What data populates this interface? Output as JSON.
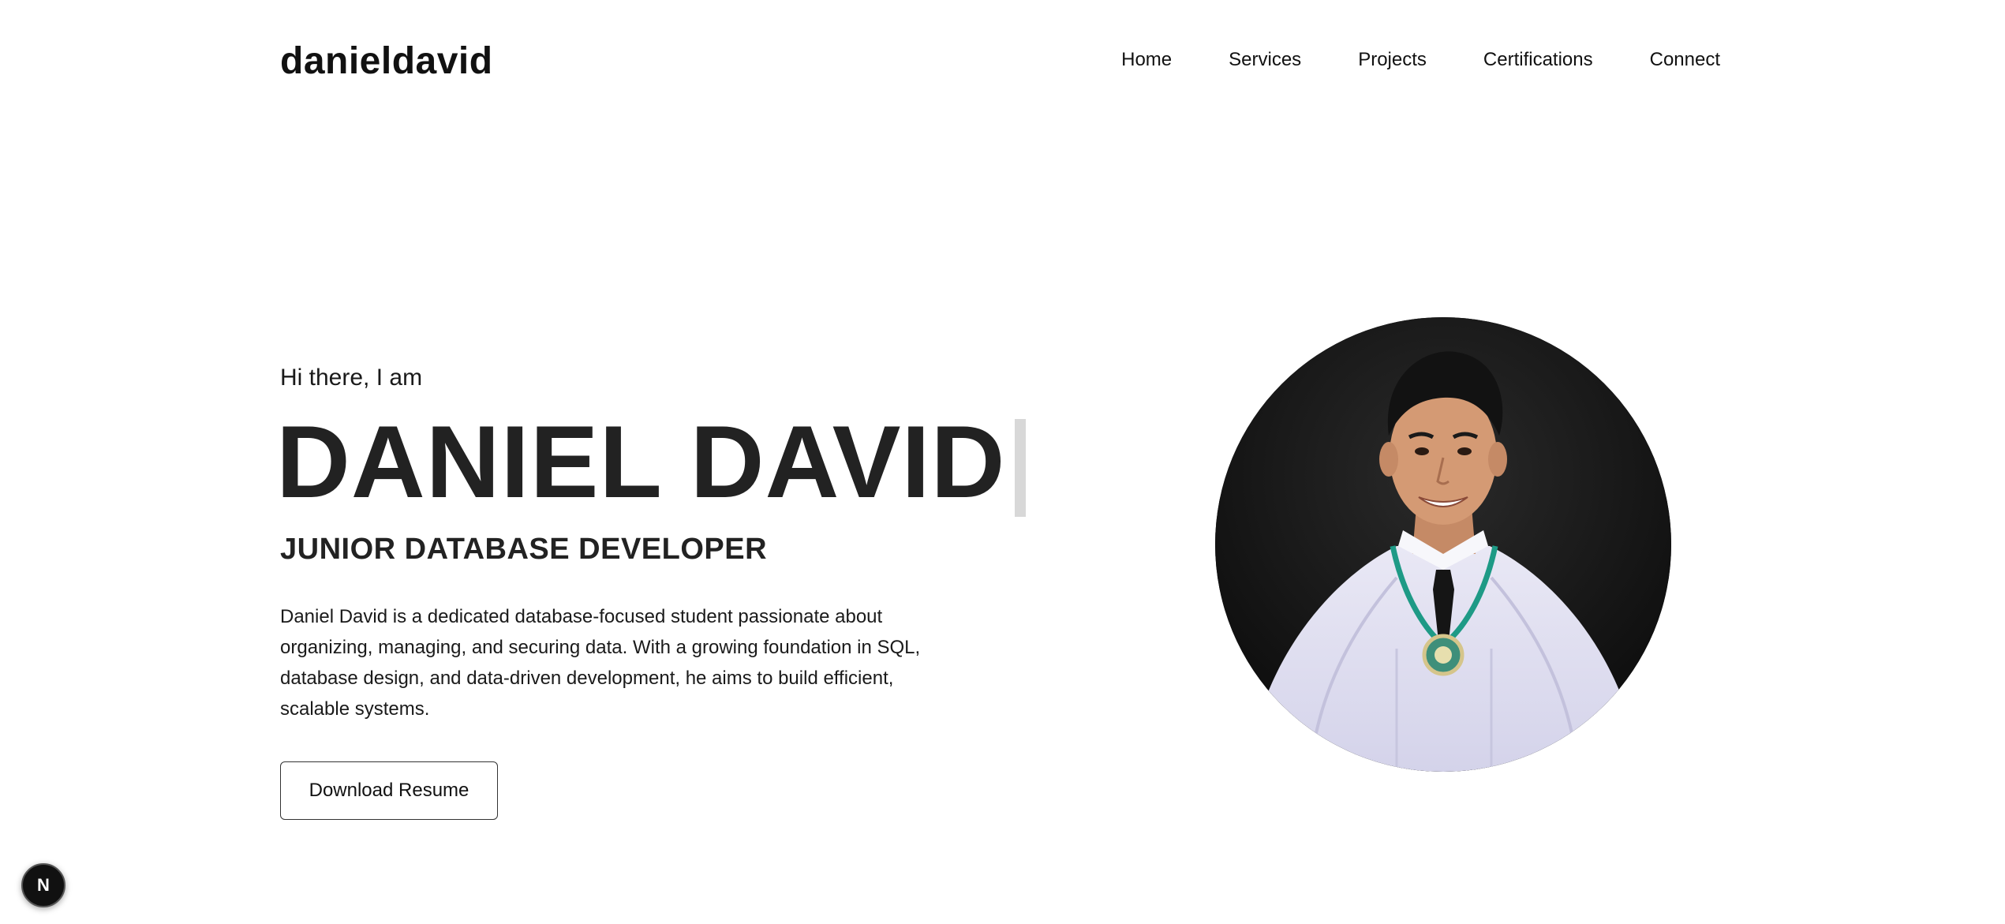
{
  "header": {
    "logo": "danieldavid",
    "nav": [
      "Home",
      "Services",
      "Projects",
      "Certifications",
      "Connect"
    ]
  },
  "hero": {
    "greeting": "Hi there, I am",
    "name": "DANIEL DAVID",
    "role": "JUNIOR DATABASE DEVELOPER",
    "bio": "Daniel David is a dedicated database-focused student passionate about organizing, managing, and securing data. With a growing foundation in SQL, database design, and data-driven development, he aims to build efficient, scalable systems.",
    "resume_button": "Download Resume"
  },
  "badge": {
    "letter": "N"
  },
  "colors": {
    "background": "#ffffff",
    "text": "#1a1a1a",
    "heading": "#222222",
    "cursor": "#d8d8d8",
    "badge": "#111111"
  }
}
